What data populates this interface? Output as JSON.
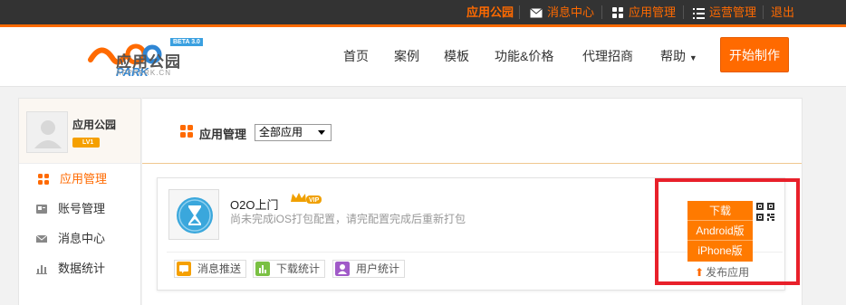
{
  "topbar": {
    "site_name": "应用公园",
    "messages": "消息中心",
    "app_manage": "应用管理",
    "ops_manage": "运营管理",
    "logout": "退出"
  },
  "header": {
    "logo_name": "应用公园",
    "logo_sub": "APPPARK.CN",
    "beta": "BETA 3.0",
    "nav": [
      "首页",
      "案例",
      "模板",
      "功能&价格",
      "代理招商",
      "帮助"
    ],
    "cta": "开始制作"
  },
  "sidebar": {
    "user_name": "应用公园",
    "level": "LV1",
    "items": [
      {
        "label": "应用管理",
        "icon": "apps-icon"
      },
      {
        "label": "账号管理",
        "icon": "account-icon"
      },
      {
        "label": "消息中心",
        "icon": "mail-icon"
      },
      {
        "label": "数据统计",
        "icon": "chart-icon"
      }
    ]
  },
  "main": {
    "title": "应用管理",
    "filter_value": "全部应用"
  },
  "app": {
    "name": "O2O上门",
    "badge": "VIP",
    "desc": "尚未完成iOS打包配置，请完配置完成后重新打包",
    "actions": [
      "消息推送",
      "下载统计",
      "用户统计"
    ],
    "download_label": "下载",
    "android_label": "Android版",
    "iphone_label": "iPhone版",
    "publish_label": "发布应用"
  },
  "colors": {
    "accent": "#ff6a00",
    "topbar": "#333333",
    "highlight": "#e8202a"
  }
}
